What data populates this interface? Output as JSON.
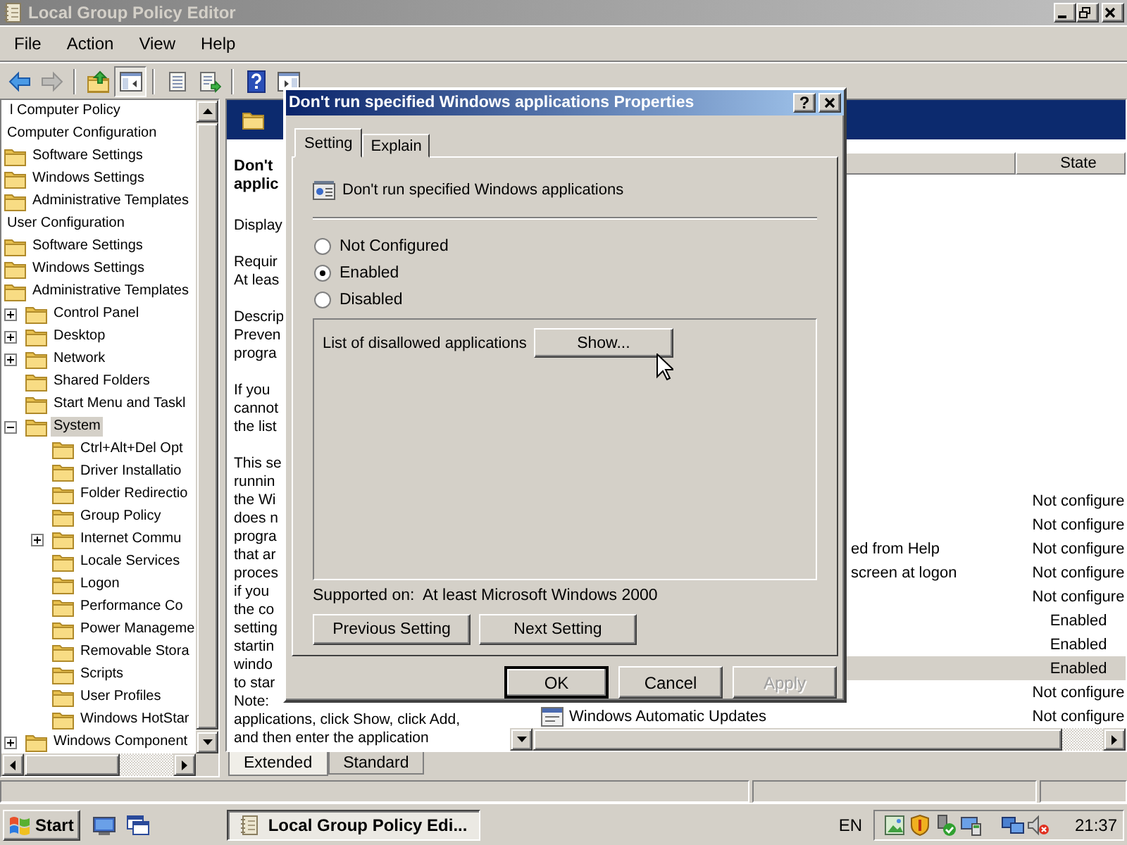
{
  "window": {
    "title": "Local Group Policy Editor"
  },
  "menu": [
    "File",
    "Action",
    "View",
    "Help"
  ],
  "toolbar_groups": [
    {
      "buttons": [
        {
          "kind": "back",
          "disabled": false,
          "pressed": false
        },
        {
          "kind": "forward",
          "disabled": true,
          "pressed": false
        }
      ]
    },
    {
      "buttons": [
        {
          "kind": "up",
          "disabled": false,
          "pressed": false
        },
        {
          "kind": "console-tree",
          "disabled": false,
          "pressed": true
        }
      ]
    },
    {
      "buttons": [
        {
          "kind": "list",
          "disabled": false,
          "pressed": false
        },
        {
          "kind": "export",
          "disabled": false,
          "pressed": false
        }
      ]
    },
    {
      "buttons": [
        {
          "kind": "help",
          "disabled": false,
          "pressed": false
        },
        {
          "kind": "panel",
          "disabled": false,
          "pressed": false
        }
      ]
    }
  ],
  "tree": [
    {
      "label": "l Computer Policy",
      "selected": false,
      "children": [
        {
          "label": "Computer Configuration",
          "selected": false,
          "children": [
            {
              "label": "Software Settings",
              "selected": false
            },
            {
              "label": "Windows Settings",
              "selected": false
            },
            {
              "label": "Administrative Templates",
              "selected": false
            }
          ]
        },
        {
          "label": "User Configuration",
          "selected": false,
          "children": [
            {
              "label": "Software Settings",
              "selected": false
            },
            {
              "label": "Windows Settings",
              "selected": false
            },
            {
              "label": "Administrative Templates",
              "selected": false,
              "children": [
                {
                  "label": "Control Panel",
                  "selected": false,
                  "expanded": false
                },
                {
                  "label": "Desktop",
                  "selected": false,
                  "expanded": false
                },
                {
                  "label": "Network",
                  "selected": false,
                  "expanded": false
                },
                {
                  "label": "Shared Folders",
                  "selected": false
                },
                {
                  "label": "Start Menu and Taskl",
                  "selected": false
                },
                {
                  "label": "System",
                  "selected": true,
                  "expanded": true,
                  "children": [
                    {
                      "label": "Ctrl+Alt+Del Opt",
                      "selected": false
                    },
                    {
                      "label": "Driver Installatio",
                      "selected": false
                    },
                    {
                      "label": "Folder Redirectio",
                      "selected": false
                    },
                    {
                      "label": "Group Policy",
                      "selected": false
                    },
                    {
                      "label": "Internet Commu",
                      "selected": false,
                      "expanded": false
                    },
                    {
                      "label": "Locale Services",
                      "selected": false
                    },
                    {
                      "label": "Logon",
                      "selected": false
                    },
                    {
                      "label": "Performance Co",
                      "selected": false
                    },
                    {
                      "label": "Power Manageme",
                      "selected": false
                    },
                    {
                      "label": "Removable Stora",
                      "selected": false
                    },
                    {
                      "label": "Scripts",
                      "selected": false
                    },
                    {
                      "label": "User Profiles",
                      "selected": false
                    },
                    {
                      "label": "Windows HotStar",
                      "selected": false
                    }
                  ]
                },
                {
                  "label": "Windows Component",
                  "selected": false,
                  "expanded": false
                }
              ]
            }
          ]
        }
      ]
    }
  ],
  "description": {
    "title_lines": [
      "Don't",
      "applic"
    ],
    "paragraphs": [
      [
        "Display"
      ],
      [
        "Requir",
        "At leas"
      ],
      [
        "Descrip",
        "Preven",
        "progra"
      ],
      [
        "If you",
        "cannot",
        "the list"
      ],
      [
        "This se",
        "runnin",
        "the Wi",
        "does n",
        "progra",
        "that ar",
        "proces",
        "if you",
        "the co",
        "setting",
        "startin",
        "windo",
        "to star",
        "Note:",
        "applications, click Show, click Add,",
        "and then enter the application"
      ]
    ]
  },
  "list": {
    "state_header": "State",
    "rows": [
      {
        "kind": "covered",
        "state": "Not configure",
        "selected": false
      },
      {
        "kind": "covered",
        "state": "Not configure",
        "selected": false
      },
      {
        "kind": "cut",
        "name": "ed from Help",
        "state": "Not configure",
        "selected": false
      },
      {
        "kind": "cut",
        "name": "screen at logon",
        "state": "Not configure",
        "selected": false
      },
      {
        "kind": "covered",
        "state": "Not configure",
        "selected": false
      },
      {
        "kind": "covered",
        "state": "Enabled",
        "selected": false
      },
      {
        "kind": "covered",
        "state": "Enabled",
        "selected": false
      },
      {
        "kind": "covered",
        "state": "Enabled",
        "selected": true
      },
      {
        "kind": "covered",
        "state": "Not configure",
        "selected": false
      },
      {
        "kind": "plain",
        "name": "Windows Automatic Updates",
        "state": "Not configure",
        "selected": false
      }
    ]
  },
  "view_tabs": [
    {
      "label": "Extended",
      "selected": true
    },
    {
      "label": "Standard",
      "selected": false
    }
  ],
  "dialog": {
    "title": "Don't run specified Windows applications Properties",
    "help_button": "?",
    "tabs": [
      {
        "label": "Setting",
        "selected": true
      },
      {
        "label": "Explain",
        "selected": false
      }
    ],
    "policy_name": "Don't run specified Windows applications",
    "options": [
      {
        "label": "Not Configured",
        "selected": false
      },
      {
        "label": "Enabled",
        "selected": true
      },
      {
        "label": "Disabled",
        "selected": false
      }
    ],
    "list_label": "List of disallowed applications",
    "show_button": "Show...",
    "supported_label": "Supported on:",
    "supported_value": "At least Microsoft Windows 2000",
    "nav_buttons": [
      "Previous Setting",
      "Next Setting"
    ],
    "buttons": [
      {
        "label": "OK",
        "default": true,
        "disabled": false
      },
      {
        "label": "Cancel",
        "default": false,
        "disabled": false
      },
      {
        "label": "Apply",
        "default": false,
        "disabled": true
      }
    ]
  },
  "taskbar": {
    "start": "Start",
    "task": "Local Group Policy Edi...",
    "language": "EN",
    "clock": "21:37"
  }
}
